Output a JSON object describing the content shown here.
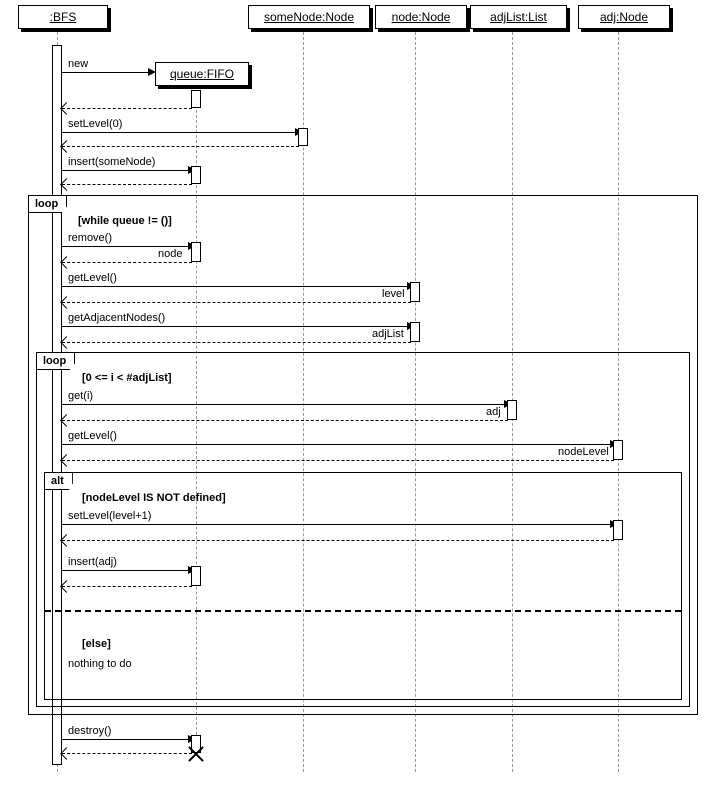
{
  "participants": {
    "bfs": ":BFS",
    "queue": "queue:FIFO",
    "someNode": "someNode:Node",
    "node": "node:Node",
    "adjList": "adjList:List",
    "adj": "adj:Node"
  },
  "messages": {
    "new": "new",
    "setLevel0": "setLevel(0)",
    "insertSome": "insert(someNode)",
    "remove": "remove()",
    "nodeReturn": "node",
    "getLevel1": "getLevel()",
    "levelReturn": "level",
    "getAdj": "getAdjacentNodes()",
    "adjListReturn": "adjList",
    "getI": "get(i)",
    "adjReturn": "adj",
    "getLevel2": "getLevel()",
    "nodeLevelReturn": "nodeLevel",
    "setLevelPlus": "setLevel(level+1)",
    "insertAdj": "insert(adj)",
    "destroy": "destroy()"
  },
  "frames": {
    "loop1": "loop",
    "loop1_guard": "[while queue != ()]",
    "loop2": "loop",
    "loop2_guard": "[0 <= i < #adjList]",
    "alt": "alt",
    "alt_guard1": "[nodeLevel IS NOT defined]",
    "alt_guard2": "[else]",
    "alt_note": "nothing to do"
  },
  "chart_data": {
    "type": "sequence_diagram",
    "participants": [
      {
        "id": "bfs",
        "name": ":BFS",
        "created_at": 0
      },
      {
        "id": "queue",
        "name": "queue:FIFO",
        "created_by": "bfs",
        "destroyed": true
      },
      {
        "id": "someNode",
        "name": "someNode:Node",
        "created_at": 0
      },
      {
        "id": "node",
        "name": "node:Node",
        "created_at": 0
      },
      {
        "id": "adjList",
        "name": "adjList:List",
        "created_at": 0
      },
      {
        "id": "adj",
        "name": "adj:Node",
        "created_at": 0
      }
    ],
    "interactions": [
      {
        "from": "bfs",
        "to": "queue",
        "label": "new",
        "type": "create"
      },
      {
        "from": "queue",
        "to": "bfs",
        "type": "return"
      },
      {
        "from": "bfs",
        "to": "someNode",
        "label": "setLevel(0)",
        "type": "call"
      },
      {
        "from": "someNode",
        "to": "bfs",
        "type": "return"
      },
      {
        "from": "bfs",
        "to": "queue",
        "label": "insert(someNode)",
        "type": "call"
      },
      {
        "from": "queue",
        "to": "bfs",
        "type": "return"
      },
      {
        "frame": "loop",
        "guard": "[while queue != ()]",
        "children": [
          {
            "from": "bfs",
            "to": "queue",
            "label": "remove()",
            "type": "call"
          },
          {
            "from": "queue",
            "to": "bfs",
            "label": "node",
            "type": "return"
          },
          {
            "from": "bfs",
            "to": "node",
            "label": "getLevel()",
            "type": "call"
          },
          {
            "from": "node",
            "to": "bfs",
            "label": "level",
            "type": "return"
          },
          {
            "from": "bfs",
            "to": "node",
            "label": "getAdjacentNodes()",
            "type": "call"
          },
          {
            "from": "node",
            "to": "bfs",
            "label": "adjList",
            "type": "return"
          },
          {
            "frame": "loop",
            "guard": "[0 <= i < #adjList]",
            "children": [
              {
                "from": "bfs",
                "to": "adjList",
                "label": "get(i)",
                "type": "call"
              },
              {
                "from": "adjList",
                "to": "bfs",
                "label": "adj",
                "type": "return"
              },
              {
                "from": "bfs",
                "to": "adj",
                "label": "getLevel()",
                "type": "call"
              },
              {
                "from": "adj",
                "to": "bfs",
                "label": "nodeLevel",
                "type": "return"
              },
              {
                "frame": "alt",
                "guard": "[nodeLevel IS NOT defined]",
                "children": [
                  {
                    "from": "bfs",
                    "to": "adj",
                    "label": "setLevel(level+1)",
                    "type": "call"
                  },
                  {
                    "from": "adj",
                    "to": "bfs",
                    "type": "return"
                  },
                  {
                    "from": "bfs",
                    "to": "queue",
                    "label": "insert(adj)",
                    "type": "call"
                  },
                  {
                    "from": "queue",
                    "to": "bfs",
                    "type": "return"
                  }
                ],
                "else": {
                  "guard": "[else]",
                  "note": "nothing to do"
                }
              }
            ]
          }
        ]
      },
      {
        "from": "bfs",
        "to": "queue",
        "label": "destroy()",
        "type": "destroy"
      },
      {
        "from": "queue",
        "to": "bfs",
        "type": "return"
      }
    ]
  }
}
